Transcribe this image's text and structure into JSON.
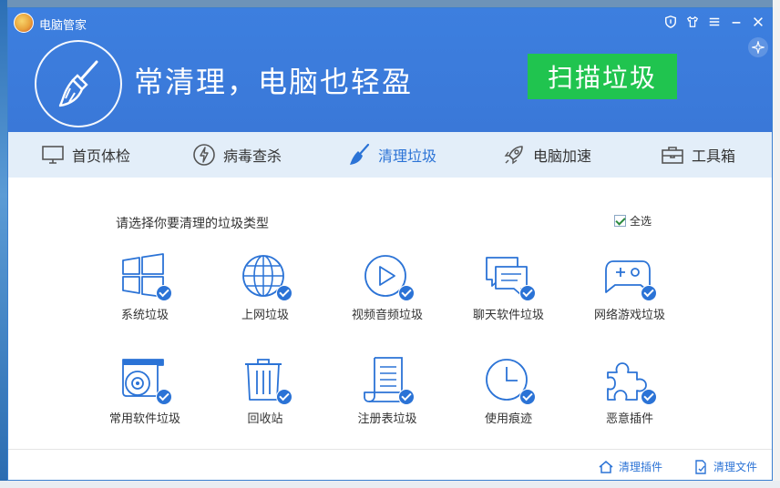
{
  "app": {
    "title": "电脑管家"
  },
  "header": {
    "slogan": "常清理，电脑也轻盈",
    "scan_button": "扫描垃圾"
  },
  "window_controls": [
    "shield-icon",
    "tshirt-icon",
    "menu-icon",
    "minimize-icon",
    "close-icon"
  ],
  "tabs": [
    {
      "label": "首页体检",
      "icon": "monitor-icon",
      "active": false
    },
    {
      "label": "病毒查杀",
      "icon": "lightning-icon",
      "active": false
    },
    {
      "label": "清理垃圾",
      "icon": "broom-icon",
      "active": true
    },
    {
      "label": "电脑加速",
      "icon": "rocket-icon",
      "active": false
    },
    {
      "label": "工具箱",
      "icon": "toolbox-icon",
      "active": false
    }
  ],
  "content": {
    "title": "请选择你要清理的垃圾类型",
    "select_all": "全选",
    "items": [
      {
        "label": "系统垃圾",
        "icon": "windows-icon",
        "checked": true
      },
      {
        "label": "上网垃圾",
        "icon": "globe-icon",
        "checked": true
      },
      {
        "label": "视频音频垃圾",
        "icon": "play-icon",
        "checked": true
      },
      {
        "label": "聊天软件垃圾",
        "icon": "chat-icon",
        "checked": true
      },
      {
        "label": "网络游戏垃圾",
        "icon": "gamepad-icon",
        "checked": true
      },
      {
        "label": "常用软件垃圾",
        "icon": "disc-icon",
        "checked": true
      },
      {
        "label": "回收站",
        "icon": "trash-icon",
        "checked": true
      },
      {
        "label": "注册表垃圾",
        "icon": "document-icon",
        "checked": true
      },
      {
        "label": "使用痕迹",
        "icon": "clock-icon",
        "checked": true
      },
      {
        "label": "恶意插件",
        "icon": "puzzle-icon",
        "checked": true
      }
    ]
  },
  "footer": {
    "clean_plugins": "清理插件",
    "clean_files": "清理文件"
  },
  "colors": {
    "header_blue": "#3d7fdf",
    "tab_bar": "#e3eef9",
    "accent": "#2b73d6",
    "scan_green": "#20c44f"
  }
}
